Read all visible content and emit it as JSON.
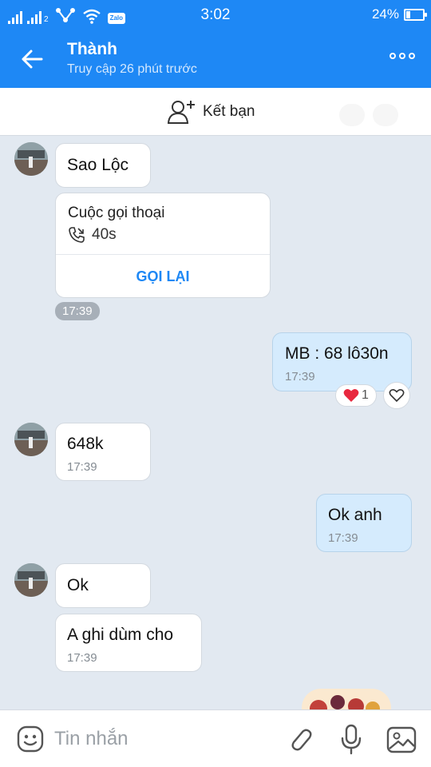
{
  "status_bar": {
    "time": "3:02",
    "battery": "24%",
    "battery_level": 0.24,
    "sim_label": "2",
    "zalo_badge": "Zalo"
  },
  "header": {
    "contact_name": "Thành",
    "last_seen": "Truy cập 26 phút trước",
    "back_icon": "arrow-left-icon",
    "more_icon": "more-icon"
  },
  "friend_bar": {
    "label": "Kết bạn",
    "icon": "add-friend-icon"
  },
  "messages": [
    {
      "sender": "them",
      "text": "Sao Lộc"
    },
    {
      "sender": "them",
      "type": "call",
      "title": "Cuộc gọi thoại",
      "duration": "40s",
      "action": "GỌI LẠI"
    },
    {
      "type": "time-pill",
      "time": "17:39"
    },
    {
      "sender": "me",
      "text": "MB : 68 lô30n",
      "time": "17:39",
      "reaction_count": "1"
    },
    {
      "sender": "them",
      "text": "648k",
      "time": "17:39"
    },
    {
      "sender": "me",
      "text": "Ok anh",
      "time": "17:39"
    },
    {
      "sender": "them",
      "text": "Ok"
    },
    {
      "sender": "them",
      "text": "A ghi dùm cho",
      "time": "17:39"
    }
  ],
  "input_bar": {
    "placeholder": "Tin nhắn",
    "icons": [
      "emoji-icon",
      "paperclip-icon",
      "microphone-icon",
      "image-icon"
    ]
  },
  "colors": {
    "brand_blue": "#1e88f5",
    "chat_background": "#e2e9f1",
    "my_bubble": "#d5ebfd",
    "their_bubble": "#ffffff",
    "reaction_heart": "#e8283e"
  }
}
